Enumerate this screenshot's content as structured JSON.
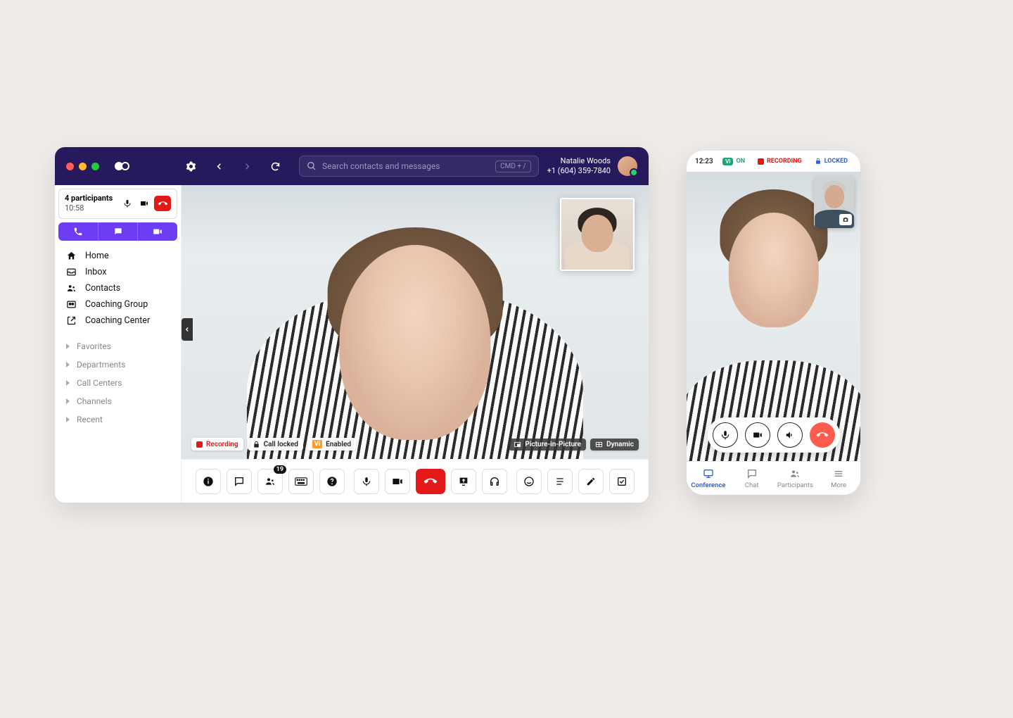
{
  "desktop": {
    "search": {
      "placeholder": "Search contacts and messages",
      "kbd": "CMD + /"
    },
    "user": {
      "name": "Natalie Woods",
      "phone": "+1 (604) 359-7840"
    },
    "callcard": {
      "title": "4 participants",
      "time": "10:58"
    },
    "nav": {
      "home": "Home",
      "inbox": "Inbox",
      "contacts": "Contacts",
      "coaching_group": "Coaching Group",
      "coaching_center": "Coaching Center"
    },
    "groups": {
      "favorites": "Favorites",
      "departments": "Departments",
      "call_centers": "Call Centers",
      "channels": "Channels",
      "recent": "Recent"
    },
    "video_badges": {
      "recording": "Recording",
      "call_locked": "Call locked",
      "vi_enabled": "Enabled",
      "pip": "Picture-in-Picture",
      "dynamic": "Dynamic"
    },
    "participants_count": "19"
  },
  "mobile": {
    "time": "12:23",
    "vi_label": "ON",
    "recording": "RECORDING",
    "locked": "LOCKED",
    "tabs": {
      "conference": "Conference",
      "chat": "Chat",
      "participants": "Participants",
      "more": "More"
    }
  }
}
